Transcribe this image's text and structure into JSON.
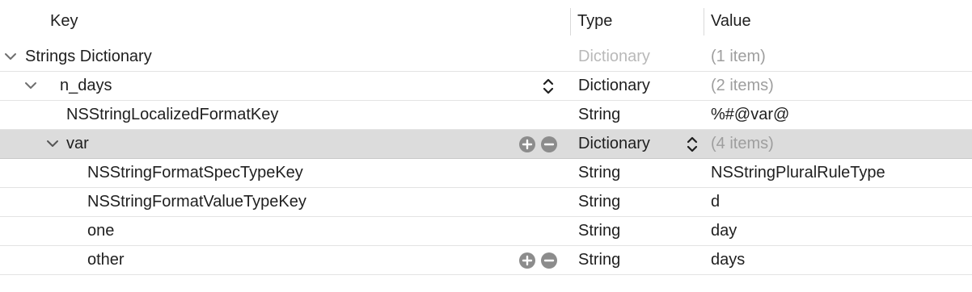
{
  "columns": {
    "key": "Key",
    "type": "Type",
    "value": "Value"
  },
  "rows": [
    {
      "key": "Strings Dictionary",
      "type": "Dictionary",
      "value": "(1 item)"
    },
    {
      "key": "n_days",
      "type": "Dictionary",
      "value": "(2 items)"
    },
    {
      "key": "NSStringLocalizedFormatKey",
      "type": "String",
      "value": "%#@var@"
    },
    {
      "key": "var",
      "type": "Dictionary",
      "value": "(4 items)"
    },
    {
      "key": "NSStringFormatSpecTypeKey",
      "type": "String",
      "value": "NSStringPluralRuleType"
    },
    {
      "key": "NSStringFormatValueTypeKey",
      "type": "String",
      "value": "d"
    },
    {
      "key": "one",
      "type": "String",
      "value": "day"
    },
    {
      "key": "other",
      "type": "String",
      "value": "days"
    }
  ],
  "icons": {
    "disclosure": "chevron-down-icon",
    "type_stepper": "up-down-chevron-icon",
    "add": "plus-circle-icon",
    "remove": "minus-circle-icon"
  },
  "colors": {
    "selected_row": "#dcdcdc",
    "muted_text": "#9e9e9e",
    "icon_gray": "#8c8c8c"
  }
}
